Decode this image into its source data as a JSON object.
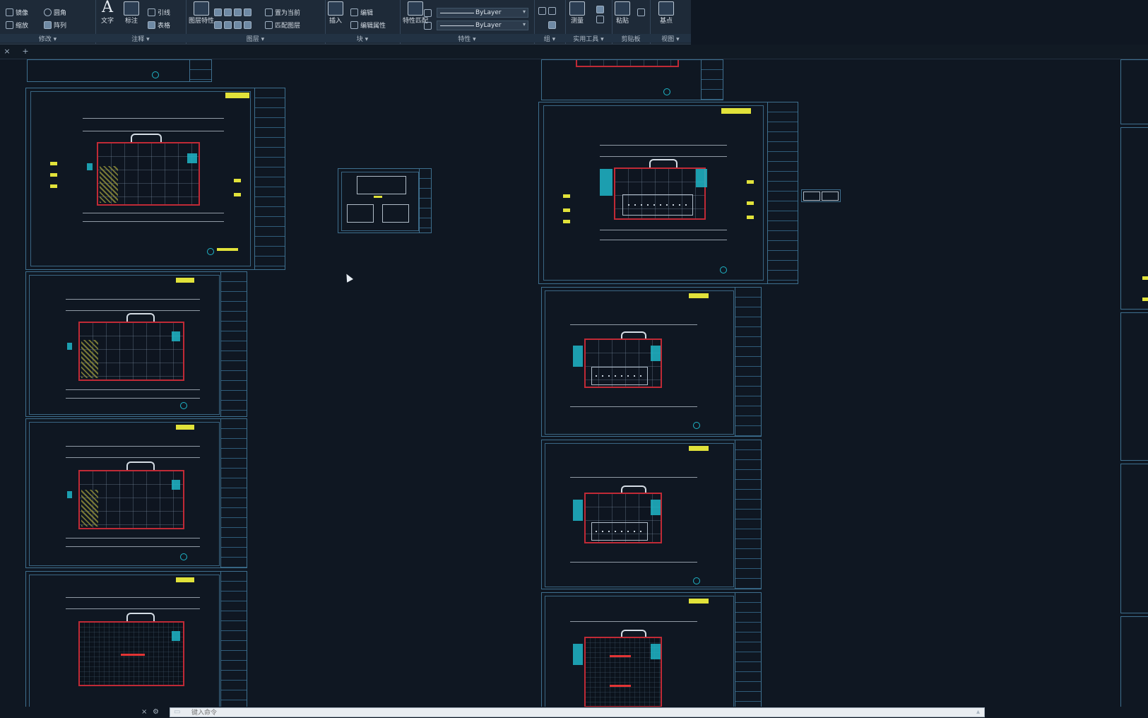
{
  "ribbon": {
    "panels": [
      {
        "title": "修改 ▾",
        "items": [
          "镜像",
          "圆角",
          "缩放",
          "阵列"
        ]
      },
      {
        "title": "注释 ▾",
        "items": [
          "文字",
          "标注",
          "引线",
          "表格"
        ]
      },
      {
        "title": "图层 ▾",
        "items": [
          "图层特性",
          "置为当前",
          "匹配图层"
        ]
      },
      {
        "title": "块 ▾",
        "items": [
          "插入",
          "编辑",
          "编辑属性"
        ]
      },
      {
        "title": "特性 ▾",
        "items": [
          "特性匹配"
        ],
        "layer_values": [
          "ByLayer",
          "ByLayer"
        ]
      },
      {
        "title": "组 ▾",
        "items": []
      },
      {
        "title": "实用工具 ▾",
        "items": [
          "测量"
        ]
      },
      {
        "title": "剪贴板",
        "items": [
          "粘贴"
        ]
      },
      {
        "title": "视图 ▾",
        "items": [
          "基点"
        ]
      }
    ]
  },
  "tabs": {
    "close_glyph": "×",
    "add_glyph": "+"
  },
  "command": {
    "placeholder": "键入命令"
  },
  "colors": {
    "accent": "#1fb6c8",
    "wall": "#c02a36",
    "frame": "#3e6f8e",
    "highlight": "#e1e23a"
  }
}
